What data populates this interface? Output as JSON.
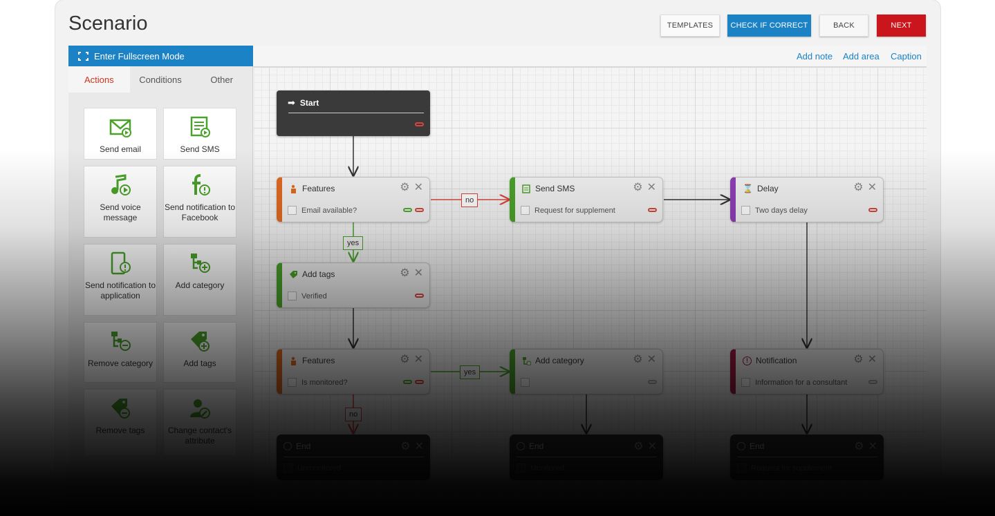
{
  "page": {
    "title": "Scenario"
  },
  "header_buttons": {
    "templates": "TEMPLATES",
    "check": "CHECK IF CORRECT",
    "back": "BACK",
    "next": "NEXT"
  },
  "fullscreen": {
    "label": "Enter Fullscreen Mode"
  },
  "toolbar": {
    "add_note": "Add note",
    "add_area": "Add area",
    "caption": "Caption"
  },
  "tabs": [
    "Actions",
    "Conditions",
    "Other"
  ],
  "palette": [
    {
      "label": "Send email",
      "icon": "envelope-icon"
    },
    {
      "label": "Send SMS",
      "icon": "sms-icon"
    },
    {
      "label": "Send voice message",
      "icon": "voice-note-icon"
    },
    {
      "label": "Send notification to Facebook",
      "icon": "facebook-notify-icon"
    },
    {
      "label": "Send notification to application",
      "icon": "mobile-notify-icon"
    },
    {
      "label": "Add category",
      "icon": "add-category-icon"
    },
    {
      "label": "Remove category",
      "icon": "remove-category-icon"
    },
    {
      "label": "Add tags",
      "icon": "add-tag-icon"
    },
    {
      "label": "Remove tags",
      "icon": "remove-tag-icon"
    },
    {
      "label": "Change contact's attribute",
      "icon": "edit-contact-icon"
    }
  ],
  "start": {
    "label": "Start"
  },
  "nodes": {
    "features1": {
      "title": "Features",
      "body": "Email available?"
    },
    "sendsms": {
      "title": "Send SMS",
      "body": "Request for supplement"
    },
    "delay": {
      "title": "Delay",
      "body": "Two days delay"
    },
    "addtags": {
      "title": "Add tags",
      "body": "Verified"
    },
    "features2": {
      "title": "Features",
      "body": "Is monitored?"
    },
    "addcategory": {
      "title": "Add category",
      "body": ""
    },
    "notification": {
      "title": "Notification",
      "body": "Information for a consultant"
    },
    "end1": {
      "title": "End",
      "body": "Unmonitored"
    },
    "end2": {
      "title": "End",
      "body": "Monitored"
    },
    "end3": {
      "title": "End",
      "body": "Request for supplement"
    }
  },
  "edge_labels": {
    "no1": "no",
    "yes1": "yes",
    "yes2": "yes",
    "no2": "no"
  },
  "colors": {
    "accent": "#1a82c5",
    "next": "#c9151b",
    "condition": "#e06a21",
    "action": "#4aa22a",
    "delay": "#8e3fb4",
    "notify": "#a11c44"
  }
}
